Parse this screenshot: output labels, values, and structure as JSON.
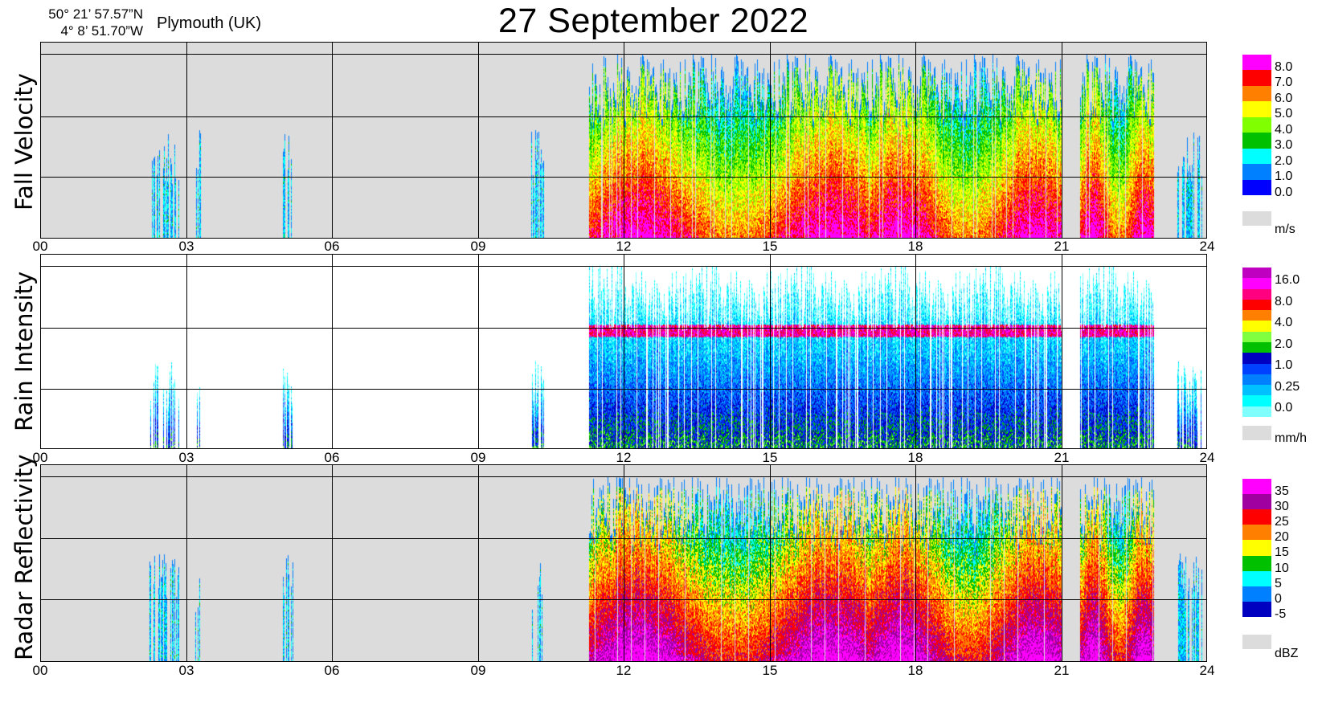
{
  "header": {
    "lat": "50° 21’ 57.57”N",
    "lon": "4°  8’ 51.70”W",
    "location": "Plymouth (UK)",
    "title": "27 September  2022"
  },
  "x_ticks": [
    "00",
    "03",
    "06",
    "09",
    "12",
    "15",
    "18",
    "21",
    "24"
  ],
  "chart_data": [
    {
      "type": "heatmap",
      "ylabel": "Fall Velocity",
      "unit": "m/s",
      "xlim": [
        0,
        24
      ],
      "x_ticks": [
        "00",
        "03",
        "06",
        "09",
        "12",
        "15",
        "18",
        "21",
        "24"
      ],
      "colorbar_labels": [
        "8.0",
        "7.0",
        "6.0",
        "5.0",
        "4.0",
        "3.0",
        "2.0",
        "1.0",
        "0.0"
      ],
      "colors": [
        "#ff00ff",
        "#ff0000",
        "#ff8000",
        "#ffff00",
        "#80ff00",
        "#00c000",
        "#00ffff",
        "#0080ff",
        "#0000ff"
      ],
      "no_data_color": "#dcdcdc",
      "background": "#dcdcdc",
      "precip_periods_h": [
        [
          2.25,
          2.6
        ],
        [
          2.6,
          2.85
        ],
        [
          3.2,
          3.3
        ],
        [
          5.0,
          5.2
        ],
        [
          10.1,
          10.35
        ],
        [
          11.3,
          17.0
        ],
        [
          17.0,
          21.0
        ],
        [
          21.4,
          22.9
        ],
        [
          23.4,
          23.9
        ]
      ]
    },
    {
      "type": "heatmap",
      "ylabel": "Rain Intensity",
      "unit": "mm/h",
      "xlim": [
        0,
        24
      ],
      "x_ticks": [
        "00",
        "03",
        "06",
        "09",
        "12",
        "15",
        "18",
        "21",
        "24"
      ],
      "colorbar_labels": [
        "16.0",
        "8.0",
        "4.0",
        "2.0",
        "1.0",
        "0.25",
        "0.0"
      ],
      "colors": [
        "#c000c0",
        "#ff00ff",
        "#ff0080",
        "#ff0000",
        "#ff8000",
        "#ffff00",
        "#80ff40",
        "#00c000",
        "#0000c0",
        "#0040ff",
        "#0080ff",
        "#00c0ff",
        "#00ffff",
        "#80ffff"
      ],
      "no_data_color": "#dcdcdc",
      "background": "#ffffff",
      "precip_periods_h": [
        [
          2.25,
          2.6
        ],
        [
          2.6,
          2.85
        ],
        [
          3.2,
          3.3
        ],
        [
          5.0,
          5.2
        ],
        [
          10.1,
          10.35
        ],
        [
          11.3,
          17.0
        ],
        [
          17.0,
          21.0
        ],
        [
          21.4,
          22.9
        ],
        [
          23.4,
          23.9
        ]
      ]
    },
    {
      "type": "heatmap",
      "ylabel": "Radar Reflectivity",
      "unit": "dBZ",
      "xlim": [
        0,
        24
      ],
      "x_ticks": [
        "00",
        "03",
        "06",
        "09",
        "12",
        "15",
        "18",
        "21",
        "24"
      ],
      "colorbar_labels": [
        "35",
        "30",
        "25",
        "20",
        "15",
        "10",
        "5",
        "0",
        "-5"
      ],
      "colors": [
        "#ff00ff",
        "#a000a0",
        "#ff0000",
        "#ff8000",
        "#ffff00",
        "#00c000",
        "#00ffff",
        "#0080ff",
        "#0000c0"
      ],
      "no_data_color": "#dcdcdc",
      "background": "#dcdcdc",
      "precip_periods_h": [
        [
          2.25,
          2.6
        ],
        [
          2.6,
          2.85
        ],
        [
          3.2,
          3.3
        ],
        [
          5.0,
          5.2
        ],
        [
          10.1,
          10.35
        ],
        [
          11.3,
          17.0
        ],
        [
          17.0,
          21.0
        ],
        [
          21.4,
          22.9
        ],
        [
          23.4,
          23.9
        ]
      ]
    }
  ]
}
